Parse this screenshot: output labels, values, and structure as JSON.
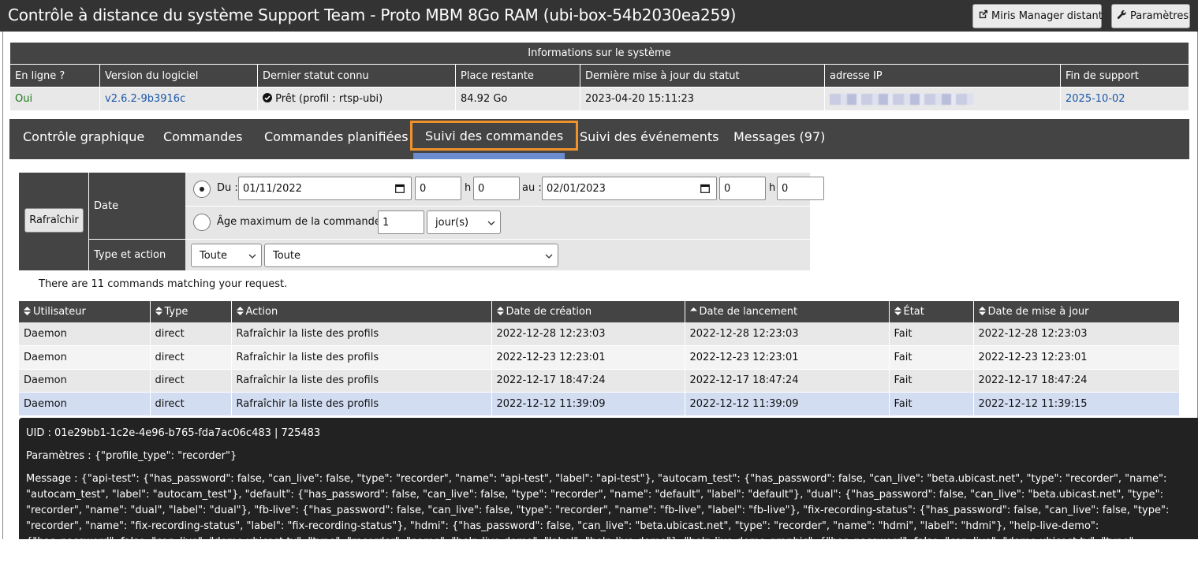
{
  "header": {
    "title": "Contrôle à distance du système Support Team - Proto MBM 8Go RAM (ubi-box-54b2030ea259)",
    "miris_button": "Miris Manager distant",
    "settings_button": "Paramètres"
  },
  "sysinfo": {
    "caption": "Informations sur le système",
    "columns": [
      "En ligne ?",
      "Version du logiciel",
      "Dernier statut connu",
      "Place restante",
      "Dernière mise à jour du statut",
      "adresse IP",
      "Fin de support"
    ],
    "online": "Oui",
    "version": "v2.6.2-9b3916c",
    "status": "Prêt (profil : rtsp-ubi)",
    "space": "84.92 Go",
    "last_update": "2023-04-20 15:11:23",
    "ip": "",
    "support_end": "2025-10-02"
  },
  "tabs": [
    {
      "label": "Contrôle graphique"
    },
    {
      "label": "Commandes"
    },
    {
      "label": "Commandes planifiées"
    },
    {
      "label": "Suivi des commandes"
    },
    {
      "label": "Suivi des événements"
    },
    {
      "label": "Messages (97)"
    }
  ],
  "filters": {
    "refresh_label": "Rafraîchir",
    "date_label": "Date",
    "type_action_label": "Type et action",
    "from_label": "Du :",
    "from_date": "01/11/2022",
    "from_hour": "0",
    "from_min": "0",
    "h_label": "h",
    "to_label": "au :",
    "to_date": "02/01/2023",
    "to_hour": "0",
    "to_min": "0",
    "age_label": "Âge maximum de la commande :",
    "age_value": "1",
    "age_unit": "jour(s)",
    "type_value": "Toute",
    "action_value": "Toute"
  },
  "results_message": "There are 11 commands matching your request.",
  "commands": {
    "columns": [
      "Utilisateur",
      "Type",
      "Action",
      "Date de création",
      "Date de lancement",
      "État",
      "Date de mise à jour"
    ],
    "rows": [
      [
        "Daemon",
        "direct",
        "Rafraîchir la liste des profils",
        "2022-12-28 12:23:03",
        "2022-12-28 12:23:03",
        "Fait",
        "2022-12-28 12:23:03"
      ],
      [
        "Daemon",
        "direct",
        "Rafraîchir la liste des profils",
        "2022-12-23 12:23:01",
        "2022-12-23 12:23:01",
        "Fait",
        "2022-12-23 12:23:01"
      ],
      [
        "Daemon",
        "direct",
        "Rafraîchir la liste des profils",
        "2022-12-17 18:47:24",
        "2022-12-17 18:47:24",
        "Fait",
        "2022-12-17 18:47:24"
      ],
      [
        "Daemon",
        "direct",
        "Rafraîchir la liste des profils",
        "2022-12-12 11:39:09",
        "2022-12-12 11:39:09",
        "Fait",
        "2022-12-12 11:39:15"
      ]
    ]
  },
  "detail": {
    "uid_label": "UID :",
    "uid_value": "01e29bb1-1c2e-4e96-b765-fda7ac06c483 | 725483",
    "params_label": "Paramètres :",
    "params_value": "{\"profile_type\": \"recorder\"}",
    "message_label": "Message :",
    "message_value": "{\"api-test\": {\"has_password\": false, \"can_live\": false, \"type\": \"recorder\", \"name\": \"api-test\", \"label\": \"api-test\"}, \"autocam_test\": {\"has_password\": false, \"can_live\": \"beta.ubicast.net\", \"type\": \"recorder\", \"name\": \"autocam_test\", \"label\": \"autocam_test\"}, \"default\": {\"has_password\": false, \"can_live\": false, \"type\": \"recorder\", \"name\": \"default\", \"label\": \"default\"}, \"dual\": {\"has_password\": false, \"can_live\": \"beta.ubicast.net\", \"type\": \"recorder\", \"name\": \"dual\", \"label\": \"dual\"}, \"fb-live\": {\"has_password\": false, \"can_live\": false, \"type\": \"recorder\", \"name\": \"fb-live\", \"label\": \"fb-live\"}, \"fix-recording-status\": {\"has_password\": false, \"can_live\": false, \"type\": \"recorder\", \"name\": \"fix-recording-status\", \"label\": \"fix-recording-status\"}, \"hdmi\": {\"has_password\": false, \"can_live\": \"beta.ubicast.net\", \"type\": \"recorder\", \"name\": \"hdmi\", \"label\": \"hdmi\"}, \"help-live-demo\": {\"has_password\": false, \"can_live\": \"demo.ubicast.tv\", \"type\": \"recorder\", \"name\": \"help-live-demo\", \"label\": \"help-live-demo\"}, \"help-live-demo-graphic\": {\"has_password\": false, \"can_live\": \"demo.ubicast.tv\", \"type\": \"recorder\", \"name\": \"help-live-demo-graphic\", \"label\": \"help-live-demo-graphic\"}, \"help-live"
  },
  "colors": {
    "accent_tab": "#f0922a",
    "underline": "#6b8cce",
    "selected_row": "#d2ddf2",
    "online_green": "#1e7a1e",
    "link_blue": "#1a57a8"
  }
}
